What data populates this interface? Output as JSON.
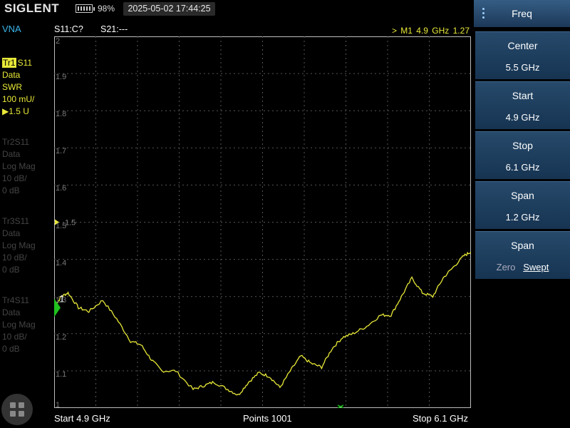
{
  "topbar": {
    "logo": "SIGLENT",
    "battery_icon": "battery-icon",
    "battery_percent": "98%",
    "datetime": "2025-05-02 17:44:25"
  },
  "mode": "VNA",
  "traces": [
    {
      "tag": "Tr1",
      "param": "S11",
      "state": "Data",
      "format": "SWR",
      "scale": "100 mU/",
      "ref": "▶1.5 U"
    },
    {
      "tag": "Tr2",
      "param": "S11",
      "state": "Data",
      "format": "Log Mag",
      "scale": "10 dB/",
      "ref": "0 dB"
    },
    {
      "tag": "Tr3",
      "param": "S11",
      "state": "Data",
      "format": "Log Mag",
      "scale": "10 dB/",
      "ref": "0 dB"
    },
    {
      "tag": "Tr4",
      "param": "S11",
      "state": "Data",
      "format": "Log Mag",
      "scale": "10 dB/",
      "ref": "0 dB"
    }
  ],
  "plot_header": {
    "s11": "S11:C?",
    "s21": "S21:---",
    "marker": "> M1   4.9 GHz   1.27"
  },
  "plot": {
    "y_labels": [
      "2",
      "1.9",
      "1.8",
      "1.7",
      "1.6",
      "1.5",
      "1.4",
      "1.3",
      "1.2",
      "1.1",
      "1"
    ],
    "marker_label": "1",
    "ref_label": "1.5",
    "colors": {
      "trace": "#e8e839",
      "grid": "#555555",
      "marker": "#1fc21f"
    }
  },
  "chart_data": {
    "type": "line",
    "xlim": [
      4.9,
      6.1
    ],
    "ylim": [
      1.0,
      2.0
    ],
    "grid": true,
    "x": [
      4.9,
      4.92,
      4.94,
      4.97,
      5.0,
      5.04,
      5.08,
      5.12,
      5.15,
      5.18,
      5.21,
      5.25,
      5.3,
      5.33,
      5.36,
      5.4,
      5.43,
      5.46,
      5.49,
      5.52,
      5.55,
      5.58,
      5.61,
      5.64,
      5.67,
      5.7,
      5.73,
      5.76,
      5.8,
      5.84,
      5.87,
      5.9,
      5.93,
      5.96,
      5.99,
      6.02,
      6.05,
      6.08,
      6.1
    ],
    "y": [
      1.27,
      1.3,
      1.31,
      1.27,
      1.26,
      1.29,
      1.24,
      1.18,
      1.17,
      1.13,
      1.1,
      1.1,
      1.05,
      1.06,
      1.07,
      1.05,
      1.035,
      1.07,
      1.095,
      1.085,
      1.055,
      1.1,
      1.14,
      1.12,
      1.11,
      1.16,
      1.19,
      1.2,
      1.22,
      1.25,
      1.25,
      1.3,
      1.35,
      1.31,
      1.3,
      1.35,
      1.38,
      1.41,
      1.42
    ],
    "marker": {
      "name": "M1",
      "x": 4.9,
      "y": 1.27
    },
    "reference_level": 1.5
  },
  "footer": {
    "start": "Start  4.9 GHz",
    "points": "Points  1001",
    "stop": "Stop  6.1 GHz"
  },
  "menu": {
    "title": "Freq",
    "buttons": [
      {
        "label": "Center",
        "value": "5.5 GHz"
      },
      {
        "label": "Start",
        "value": "4.9 GHz"
      },
      {
        "label": "Stop",
        "value": "6.1 GHz"
      },
      {
        "label": "Span",
        "value": "1.2 GHz"
      }
    ],
    "sweep": {
      "label": "Span",
      "opt_off": "Zero",
      "opt_on": "Swept"
    }
  },
  "icons": [
    "battery-icon",
    "menu-dots-icon",
    "apps-grid-icon",
    "marker-triangle-icon",
    "reference-arrow-icon"
  ]
}
